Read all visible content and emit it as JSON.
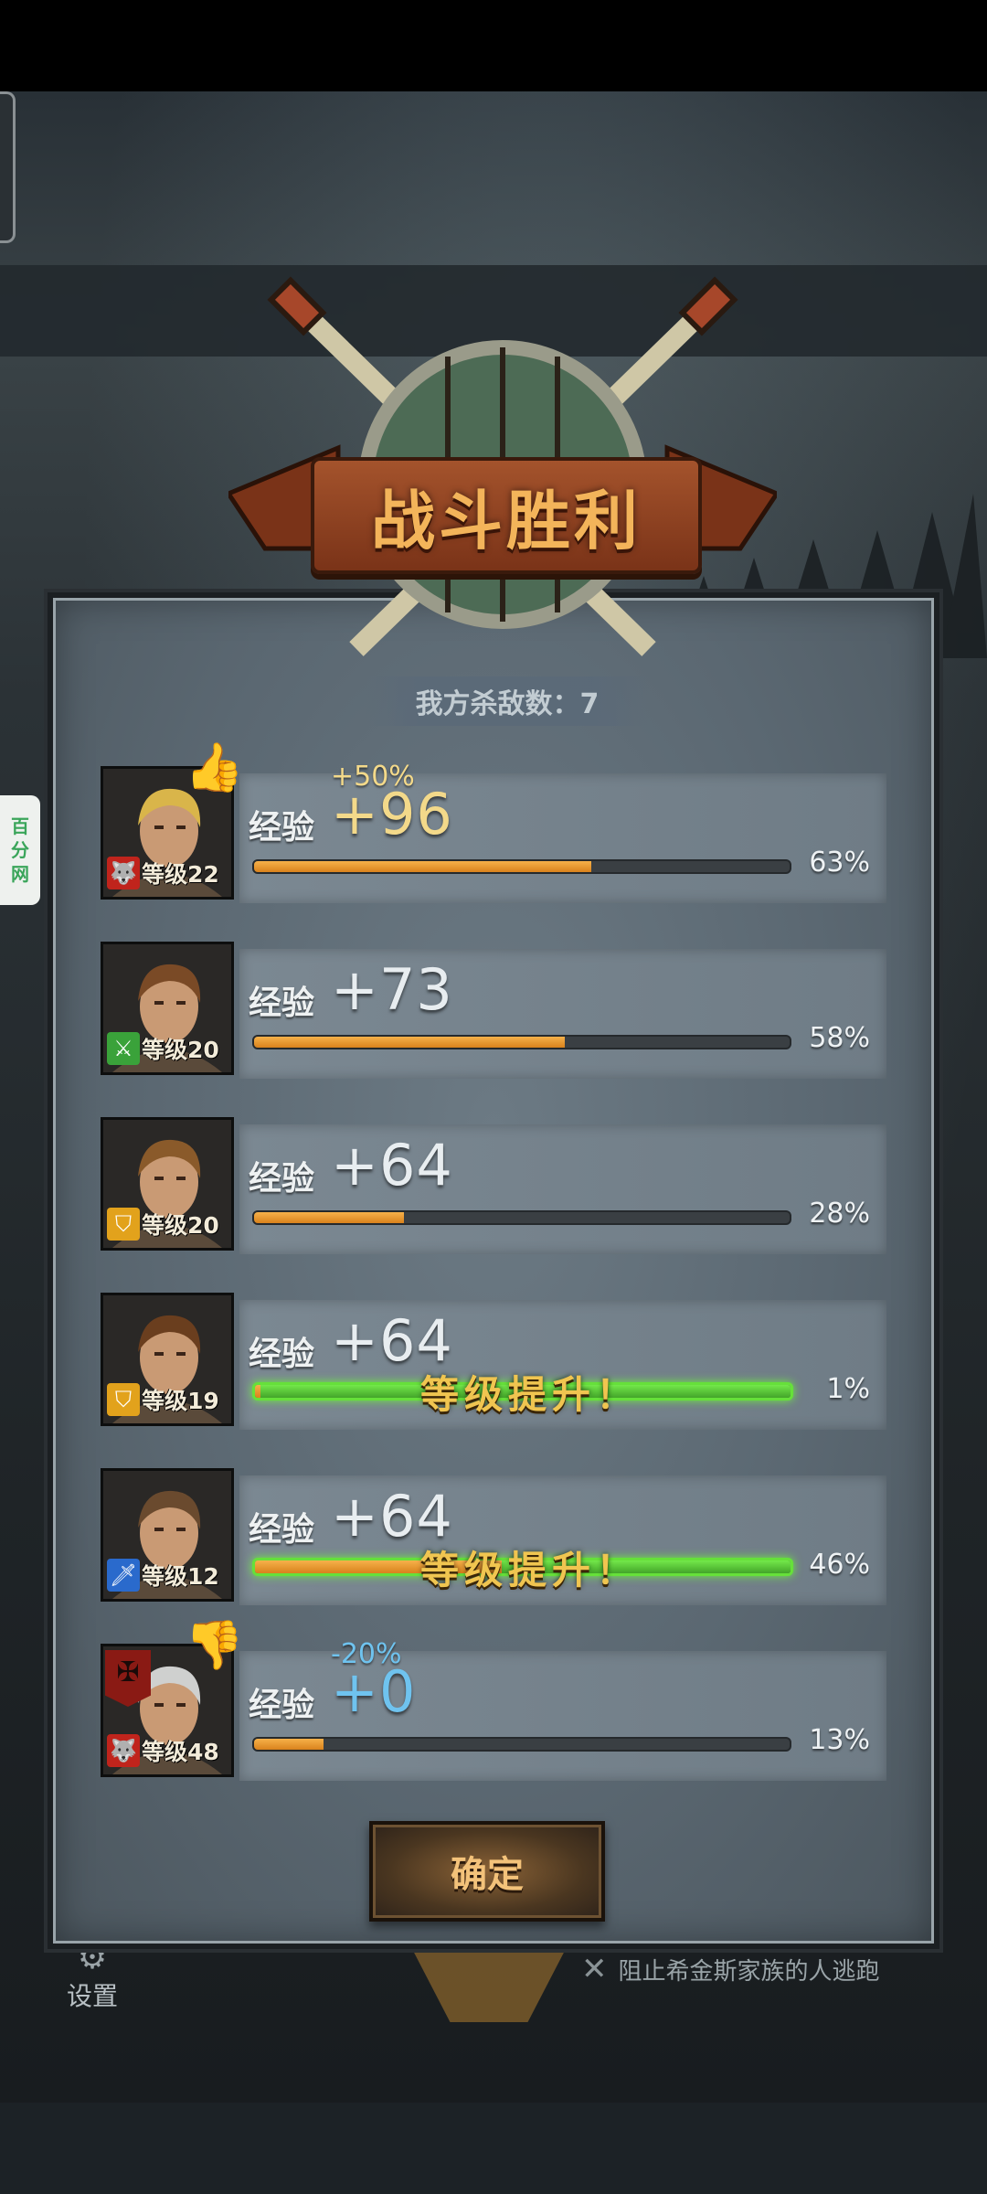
{
  "title": "战斗胜利",
  "kills_label": "我方杀敌数：7",
  "side_badge": [
    "百",
    "分",
    "网"
  ],
  "confirm_label": "确定",
  "hud": {
    "settings_label": "设置",
    "objective": "阻止希金斯家族的人逃跑"
  },
  "exp_label": "经验",
  "levelup_text": "等级提升！",
  "heroes": [
    {
      "level": "等级22",
      "exp": "+96",
      "bonus": "+50%",
      "percent": "63%",
      "progress": 0.63,
      "levelup": false,
      "badge": "thumbs-up-icon",
      "class_icon": "wolf-icon",
      "class_color": "#c0241c"
    },
    {
      "level": "等级20",
      "exp": "+73",
      "bonus": "",
      "percent": "58%",
      "progress": 0.58,
      "levelup": false,
      "badge": "",
      "class_icon": "crossed-swords-icon",
      "class_color": "#3aa23a"
    },
    {
      "level": "等级20",
      "exp": "+64",
      "bonus": "",
      "percent": "28%",
      "progress": 0.28,
      "levelup": false,
      "badge": "",
      "class_icon": "shield-icon",
      "class_color": "#e2a21c"
    },
    {
      "level": "等级19",
      "exp": "+64",
      "bonus": "",
      "percent": "1%",
      "progress": 0.01,
      "levelup": true,
      "badge": "",
      "class_icon": "shield-icon",
      "class_color": "#e2a21c"
    },
    {
      "level": "等级12",
      "exp": "+64",
      "bonus": "",
      "percent": "46%",
      "progress": 0.46,
      "levelup": true,
      "badge": "",
      "class_icon": "sword-icon",
      "class_color": "#2a6acc"
    },
    {
      "level": "等级48",
      "exp": "+0",
      "bonus": "-20%",
      "percent": "13%",
      "progress": 0.13,
      "levelup": false,
      "badge": "thumbs-down-icon",
      "class_icon": "wolf-icon",
      "class_color": "#c0241c"
    }
  ]
}
